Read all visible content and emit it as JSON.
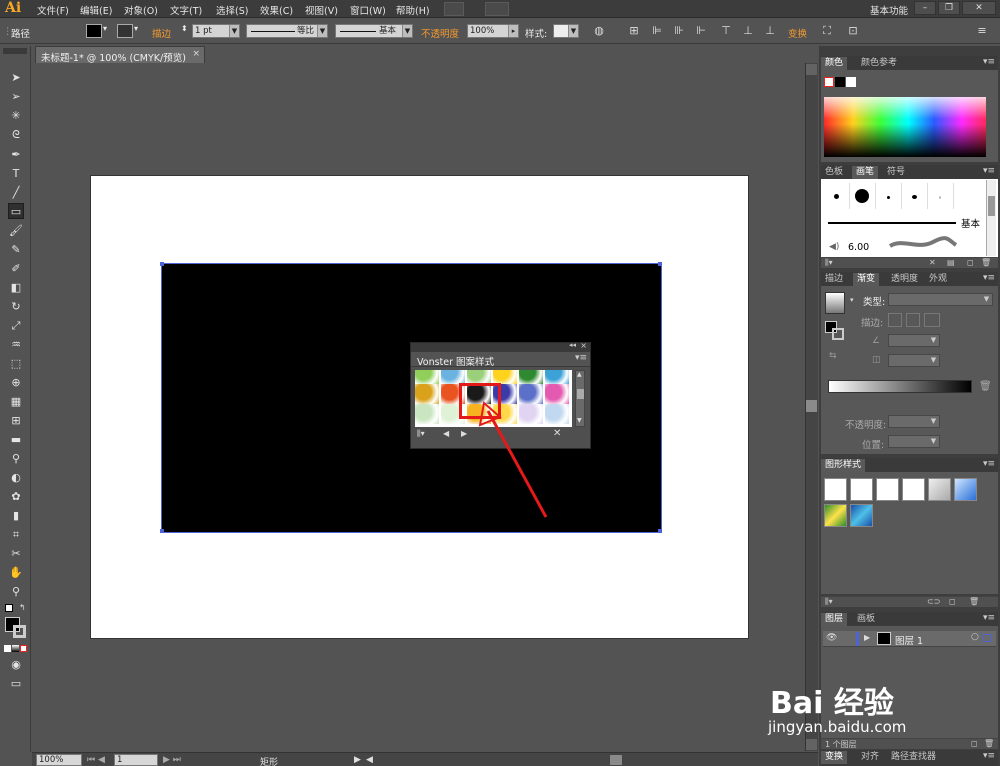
{
  "app": {
    "logo": "Ai",
    "menus": [
      "文件(F)",
      "编辑(E)",
      "对象(O)",
      "文字(T)",
      "选择(S)",
      "效果(C)",
      "视图(V)",
      "窗口(W)",
      "帮助(H)"
    ],
    "workspace": "基本功能",
    "window_controls": [
      "minimize-icon",
      "restore-icon",
      "close-icon"
    ]
  },
  "control_bar": {
    "selection_label": "路径",
    "stroke_label": "描边",
    "stroke_weight": "1 pt",
    "profile_label": "等比",
    "brush_label": "基本",
    "opacity_label": "不透明度",
    "opacity_value": "100%",
    "style_label": "样式:",
    "transform_label": "变换"
  },
  "document": {
    "tab_title": "未标题-1* @ 100% (CMYK/预览)",
    "zoom": "100%",
    "artboard_number": "1",
    "status_label": "矩形"
  },
  "toolbar": {
    "tools": [
      "selection-tool-icon",
      "direct-selection-tool-icon",
      "magic-wand-tool-icon",
      "lasso-tool-icon",
      "pen-tool-icon",
      "type-tool-icon",
      "line-segment-tool-icon",
      "rectangle-tool-icon",
      "paintbrush-tool-icon",
      "pencil-tool-icon",
      "blob-brush-tool-icon",
      "eraser-tool-icon",
      "rotate-tool-icon",
      "scale-tool-icon",
      "warp-tool-icon",
      "free-transform-tool-icon",
      "shape-builder-tool-icon",
      "perspective-grid-tool-icon",
      "mesh-tool-icon",
      "gradient-tool-icon",
      "eyedropper-tool-icon",
      "blend-tool-icon",
      "symbol-sprayer-tool-icon",
      "column-graph-tool-icon",
      "artboard-tool-icon",
      "slice-tool-icon",
      "hand-tool-icon",
      "zoom-tool-icon"
    ],
    "selected_tool": "rectangle-tool-icon"
  },
  "panels": {
    "color": {
      "tabs": [
        "颜色",
        "颜色参考"
      ]
    },
    "brushes": {
      "tabs": [
        "色板",
        "画笔",
        "符号"
      ],
      "brush_name": "基本",
      "brush_size": "6.00"
    },
    "gradient": {
      "tabs": [
        "描边",
        "渐变",
        "透明度",
        "外观"
      ],
      "type_label": "类型:",
      "stroke_label": "描边:",
      "opacity_label": "不透明度:",
      "location_label": "位置:"
    },
    "graphic_styles": {
      "tabs": [
        "图形样式"
      ]
    },
    "layers": {
      "tabs": [
        "图层",
        "画板"
      ],
      "layer_name": "图层 1",
      "footer_label": "1 个图层"
    },
    "bottom": {
      "tabs": [
        "变换",
        "对齐",
        "路径查找器"
      ]
    }
  },
  "floating_panel": {
    "title": "Vonster 图案样式",
    "swatch_colors": [
      [
        "#8fcf5a",
        "#6ab3e0",
        "#9bd07a",
        "#ffd21c",
        "#2e8a30",
        "#3ba2d8"
      ],
      [
        "#d9a21a",
        "#e8531f",
        "#1a1a1a",
        "#3a3aa8",
        "#5c6fc9",
        "#e35ab0"
      ],
      [
        "#c9e6c1",
        "#e0f2d5",
        "#f7b21f",
        "#ffd84a",
        "#e0d4f2",
        "#c0d8f0"
      ]
    ],
    "highlight_color": "#e41a1a"
  },
  "watermark": {
    "logo_text": "Bai 经验",
    "url": "jingyan.baidu.com"
  }
}
